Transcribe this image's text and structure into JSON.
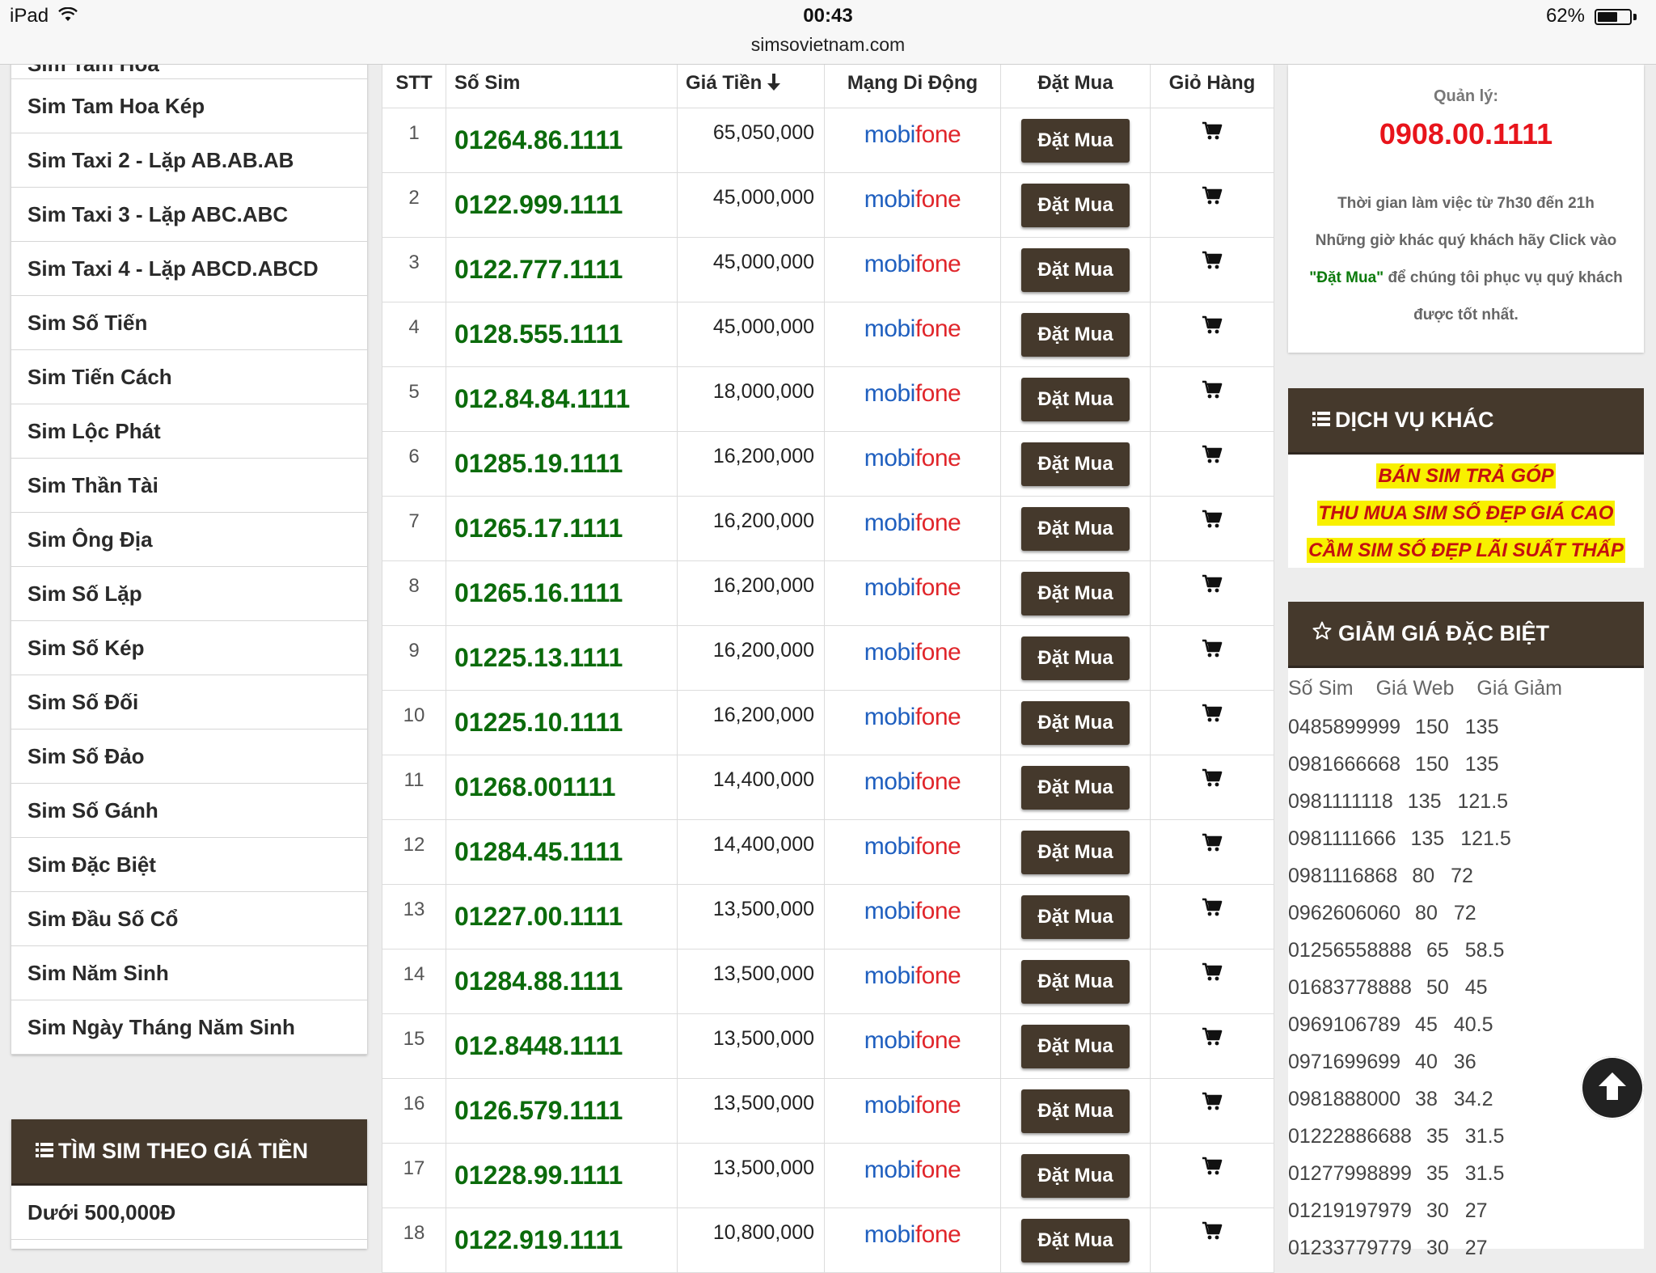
{
  "status_bar": {
    "device": "iPad",
    "time": "00:43",
    "battery_text": "62%",
    "battery_level": 0.62
  },
  "browser": {
    "url": "simsovietnam.com"
  },
  "sidebar": {
    "first_item": "Sim Tam Hoa",
    "items": [
      "Sim Tam Hoa Kép",
      "Sim Taxi 2 - Lặp AB.AB.AB",
      "Sim Taxi 3 - Lặp ABC.ABC",
      "Sim Taxi 4 - Lặp ABCD.ABCD",
      "Sim Số Tiến",
      "Sim Tiến Cách",
      "Sim Lộc Phát",
      "Sim Thần Tài",
      "Sim Ông Địa",
      "Sim Số Lặp",
      "Sim Số Kép",
      "Sim Số Đối",
      "Sim Số Đảo",
      "Sim Số Gánh",
      "Sim Đặc Biệt",
      "Sim Đầu Số Cổ",
      "Sim Năm Sinh",
      "Sim Ngày Tháng Năm Sinh"
    ],
    "price_search": {
      "title": "TÌM SIM THEO GIÁ TIỀN",
      "first_item": "Dưới 500,000Đ"
    }
  },
  "table": {
    "headers": {
      "stt": "STT",
      "number": "Số Sim",
      "price": "Giá Tiền",
      "network": "Mạng Di Động",
      "buy": "Đặt Mua",
      "cart": "Giỏ Hàng"
    },
    "buy_label": "Đặt Mua",
    "network_logo": {
      "part1": "mobi",
      "part2": "fone"
    },
    "rows": [
      {
        "stt": "1",
        "number": "01264.86.1111",
        "price": "65,050,000"
      },
      {
        "stt": "2",
        "number": "0122.999.1111",
        "price": "45,000,000"
      },
      {
        "stt": "3",
        "number": "0122.777.1111",
        "price": "45,000,000"
      },
      {
        "stt": "4",
        "number": "0128.555.1111",
        "price": "45,000,000"
      },
      {
        "stt": "5",
        "number": "012.84.84.1111",
        "price": "18,000,000"
      },
      {
        "stt": "6",
        "number": "01285.19.1111",
        "price": "16,200,000"
      },
      {
        "stt": "7",
        "number": "01265.17.1111",
        "price": "16,200,000"
      },
      {
        "stt": "8",
        "number": "01265.16.1111",
        "price": "16,200,000"
      },
      {
        "stt": "9",
        "number": "01225.13.1111",
        "price": "16,200,000"
      },
      {
        "stt": "10",
        "number": "01225.10.1111",
        "price": "16,200,000"
      },
      {
        "stt": "11",
        "number": "01268.001111",
        "price": "14,400,000"
      },
      {
        "stt": "12",
        "number": "01284.45.1111",
        "price": "14,400,000"
      },
      {
        "stt": "13",
        "number": "01227.00.1111",
        "price": "13,500,000"
      },
      {
        "stt": "14",
        "number": "01284.88.1111",
        "price": "13,500,000"
      },
      {
        "stt": "15",
        "number": "012.8448.1111",
        "price": "13,500,000"
      },
      {
        "stt": "16",
        "number": "0126.579.1111",
        "price": "13,500,000"
      },
      {
        "stt": "17",
        "number": "01228.99.1111",
        "price": "13,500,000"
      },
      {
        "stt": "18",
        "number": "0122.919.1111",
        "price": "10,800,000"
      }
    ]
  },
  "manager": {
    "label": "Quản lý:",
    "phone": "0908.00.1111",
    "line1": "Thời gian làm việc từ 7h30 đến 21h",
    "line2": "Những giờ khác quý khách hãy Click vào",
    "line3_highlight": "\"Đặt Mua\"",
    "line3_rest": " để chúng tôi phục vụ quý khách",
    "line4": "được tốt nhất."
  },
  "services": {
    "title": "DỊCH VỤ KHÁC",
    "items": [
      "BÁN SIM TRẢ GÓP",
      "THU MUA SIM SỐ ĐẸP GIÁ CAO",
      "CẦM SIM SỐ ĐẸP LÃI SUẤT THẤP"
    ]
  },
  "discount": {
    "title": "GIẢM GIÁ ĐẶC BIỆT",
    "headers": [
      "Số Sim",
      "Giá Web",
      "Giá Giảm"
    ],
    "rows": [
      [
        "0485899999",
        "150",
        "135"
      ],
      [
        "0981666668",
        "150",
        "135"
      ],
      [
        "0981111118",
        "135",
        "121.5"
      ],
      [
        "0981111666",
        "135",
        "121.5"
      ],
      [
        "0981116868",
        "80",
        "72"
      ],
      [
        "0962606060",
        "80",
        "72"
      ],
      [
        "01256558888",
        "65",
        "58.5"
      ],
      [
        "01683778888",
        "50",
        "45"
      ],
      [
        "0969106789",
        "45",
        "40.5"
      ],
      [
        "0971699699",
        "40",
        "36"
      ],
      [
        "0981888000",
        "38",
        "34.2"
      ],
      [
        "01222886688",
        "35",
        "31.5"
      ],
      [
        "01277998899",
        "35",
        "31.5"
      ],
      [
        "01219197979",
        "30",
        "27"
      ],
      [
        "01233779779",
        "30",
        "27"
      ]
    ]
  },
  "colors": {
    "accent_dark": "#45392c",
    "number_green": "#0b6b0b",
    "manager_red": "#e8141b",
    "highlight_yellow": "#f8f000",
    "highlight_text": "#c41010"
  }
}
